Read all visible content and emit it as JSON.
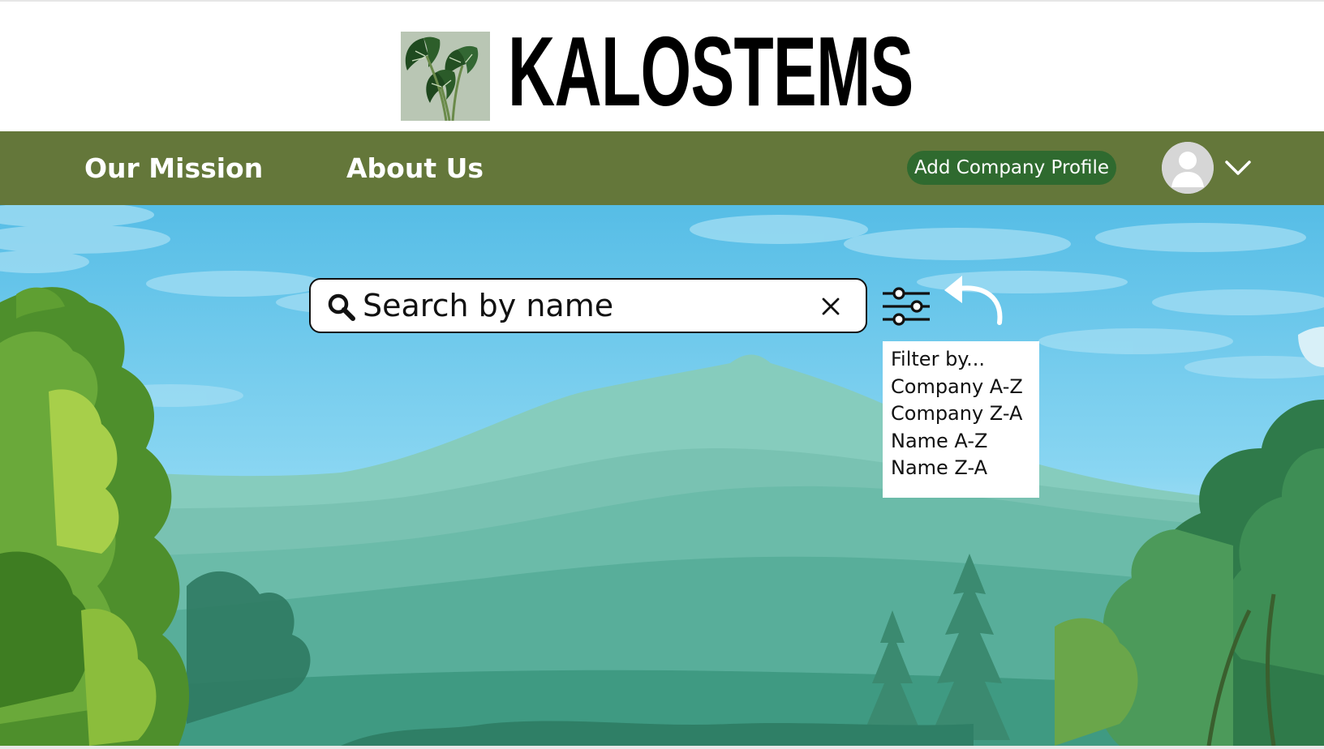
{
  "brand": {
    "name": "KALOSTEMS",
    "logo_icon": "leaf-plant-icon"
  },
  "nav": {
    "links": [
      {
        "label": "Our Mission"
      },
      {
        "label": "About Us"
      }
    ],
    "add_profile_label": "Add Company Profile",
    "avatar_icon": "user-avatar-icon",
    "menu_icon": "chevron-down-icon"
  },
  "search": {
    "value": "",
    "placeholder": "Search by name",
    "search_icon": "search-icon",
    "clear_icon": "close-icon"
  },
  "filter": {
    "icon": "sliders-icon",
    "pointer_icon": "curved-arrow-icon",
    "title": "Filter by...",
    "options": [
      {
        "label": "Company A-Z"
      },
      {
        "label": "Company Z-A"
      },
      {
        "label": "Name A-Z"
      },
      {
        "label": "Name Z-A"
      }
    ]
  },
  "colors": {
    "nav_bg": "#64773a",
    "button_bg": "#2f6a2f",
    "sky": "#5bbfe6",
    "mountain": "#7fc7b6"
  }
}
